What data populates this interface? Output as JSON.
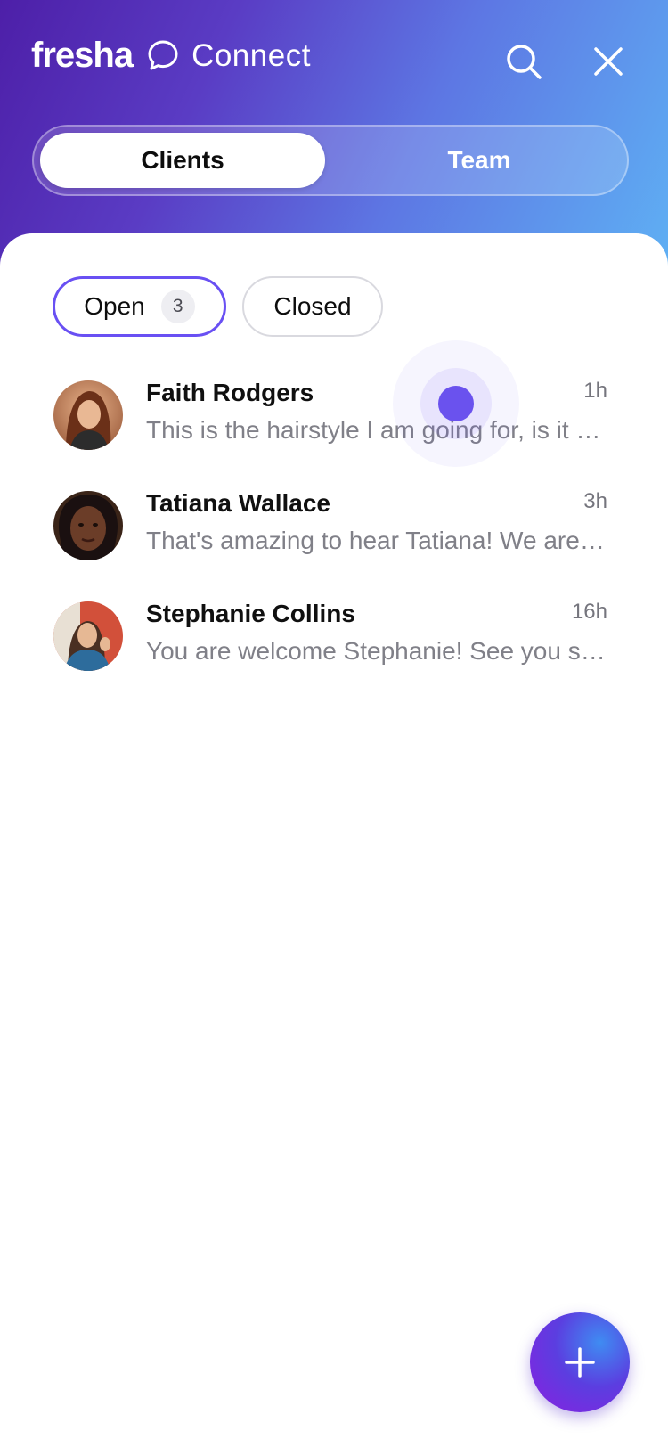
{
  "header": {
    "brand_logo": "fresha",
    "brand_product": "Connect",
    "brand_icon": "chat-bubble-icon",
    "search_icon": "search-icon",
    "close_icon": "close-icon"
  },
  "segmented": {
    "options": [
      {
        "label": "Clients",
        "selected": true
      },
      {
        "label": "Team",
        "selected": false
      }
    ]
  },
  "filters": {
    "open": {
      "label": "Open",
      "count": "3",
      "selected": true
    },
    "closed": {
      "label": "Closed",
      "selected": false
    }
  },
  "conversations": [
    {
      "name": "Faith Rodgers",
      "time": "1h",
      "preview": "This is the hairstyle I am going for, is it possible to book an appointment?"
    },
    {
      "name": "Tatiana Wallace",
      "time": "3h",
      "preview": "That's amazing to hear Tatiana! We are looking forward to seeing you."
    },
    {
      "name": "Stephanie Collins",
      "time": "16h",
      "preview": "You are welcome Stephanie! See you soon."
    }
  ],
  "fab": {
    "icon": "plus-icon"
  },
  "colors": {
    "accent": "#6950f3",
    "header_gradient_start": "#4d1fa8",
    "header_gradient_end": "#5fb1f4",
    "text_primary": "#101010",
    "text_secondary": "#808088"
  }
}
